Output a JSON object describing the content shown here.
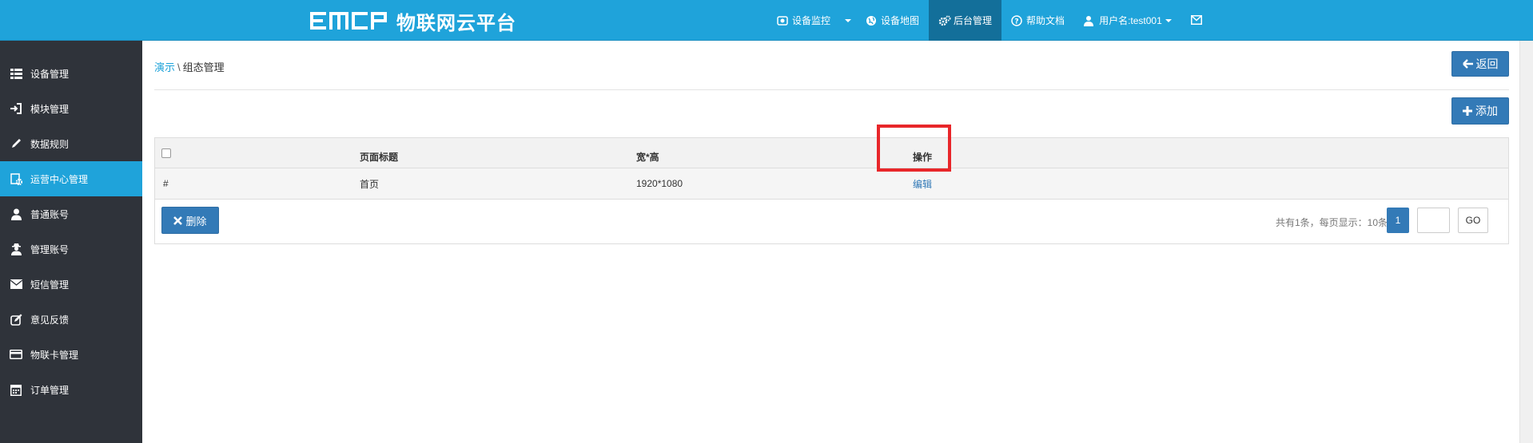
{
  "header": {
    "brand_name": "物联网云平台",
    "nav": [
      {
        "label": "设备监控",
        "icon": "camera-icon"
      },
      {
        "label": "设备地图",
        "icon": "globe-icon"
      },
      {
        "label": "后台管理",
        "icon": "gears-icon",
        "active": true
      },
      {
        "label": "帮助文档",
        "icon": "question-circle-icon"
      },
      {
        "label": "用户名:test001",
        "icon": "user-icon"
      },
      {
        "label": "",
        "icon": "envelope-icon"
      }
    ]
  },
  "sidebar": {
    "items": [
      {
        "label": "设备管理",
        "icon": "list-icon"
      },
      {
        "label": "模块管理",
        "icon": "sign-in-icon"
      },
      {
        "label": "数据规则",
        "icon": "pencil-icon"
      },
      {
        "label": "运营中心管理",
        "icon": "cog-icon",
        "active": true
      },
      {
        "label": "普通账号",
        "icon": "user-icon"
      },
      {
        "label": "管理账号",
        "icon": "user-secret-icon"
      },
      {
        "label": "短信管理",
        "icon": "envelope-icon"
      },
      {
        "label": "意见反馈",
        "icon": "edit-icon"
      },
      {
        "label": "物联卡管理",
        "icon": "credit-card-icon"
      },
      {
        "label": "订单管理",
        "icon": "calendar-icon"
      }
    ]
  },
  "breadcrumb": {
    "parent": "演示",
    "separator": "\\",
    "current": "组态管理"
  },
  "buttons": {
    "back": "返回",
    "add": "添加",
    "delete": "删除",
    "go": "GO"
  },
  "table": {
    "columns": [
      "",
      "页面标题",
      "宽*高",
      "操作"
    ],
    "rows": [
      {
        "index": "#",
        "title": "首页",
        "size": "1920*1080",
        "action": "编辑"
      }
    ]
  },
  "pagination": {
    "info": "共有1条，每页显示：10条",
    "current_page": "1",
    "page_input": ""
  },
  "colors": {
    "topbar": "#1fa3da",
    "sidebar": "#2f333a",
    "active_nav": "#136f9a",
    "primary": "#337ab7",
    "highlight": "#e8262a"
  }
}
